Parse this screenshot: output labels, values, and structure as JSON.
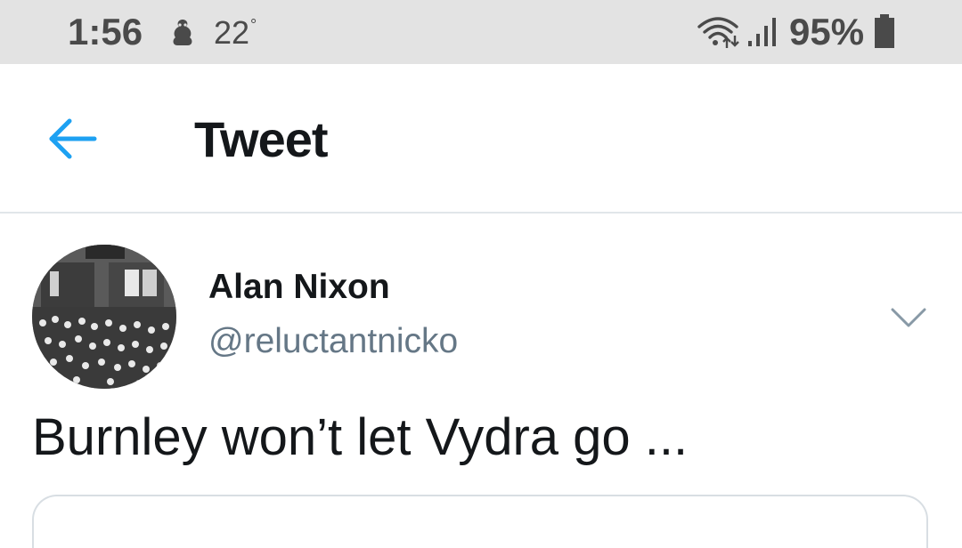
{
  "status_bar": {
    "time": "1:56",
    "weather_icon": "weather-icon",
    "temperature": "22",
    "degree_symbol": "°",
    "wifi_icon": "wifi-icon",
    "signal_icon": "signal-icon",
    "battery_percent": "95%",
    "battery_icon": "battery-icon"
  },
  "header": {
    "back_icon": "arrow-left-icon",
    "title": "Tweet"
  },
  "tweet": {
    "author_name": "Alan Nixon",
    "author_handle": "@reluctantnicko",
    "more_icon": "chevron-down-icon",
    "text": "Burnley won’t let Vydra go ..."
  },
  "colors": {
    "accent": "#1da1f2",
    "text_primary": "#14171a",
    "text_secondary": "#657786",
    "status_bar_bg": "#e3e3e3"
  }
}
